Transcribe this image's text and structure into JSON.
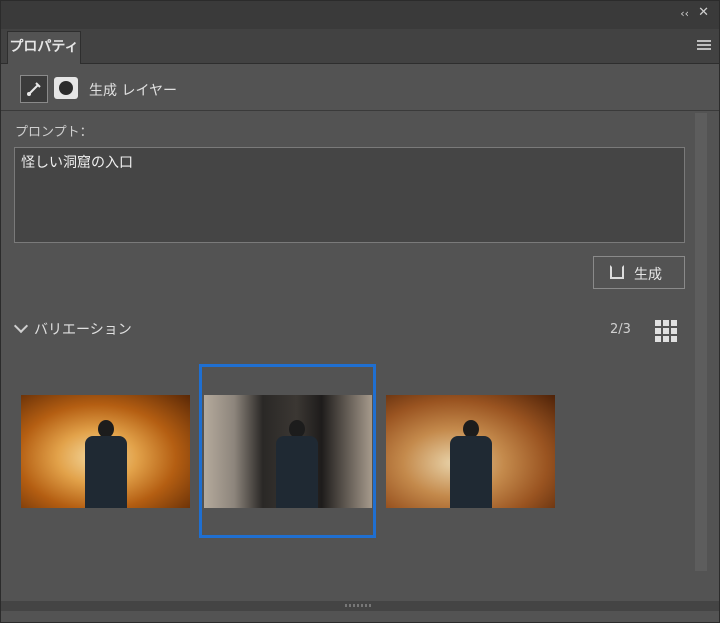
{
  "header": {
    "collapse_label": "‹‹",
    "close_label": "✕",
    "tab_label": "プロパティ"
  },
  "layer": {
    "name": "生成 レイヤー",
    "icons": [
      "generate-layer-icon",
      "mask-icon"
    ]
  },
  "prompt": {
    "label": "プロンプト：",
    "value": "怪しい洞窟の入口"
  },
  "generate_button": {
    "label": "生成",
    "icon": "generate-icon"
  },
  "variations": {
    "label": "バリエーション",
    "count": "2/3",
    "selected_index": 1,
    "items": [
      {
        "description": "orange cave tunnel"
      },
      {
        "description": "gray rock cave"
      },
      {
        "description": "brown cave arch"
      }
    ]
  },
  "colors": {
    "selection": "#1f6fd1",
    "panel": "#535353"
  }
}
